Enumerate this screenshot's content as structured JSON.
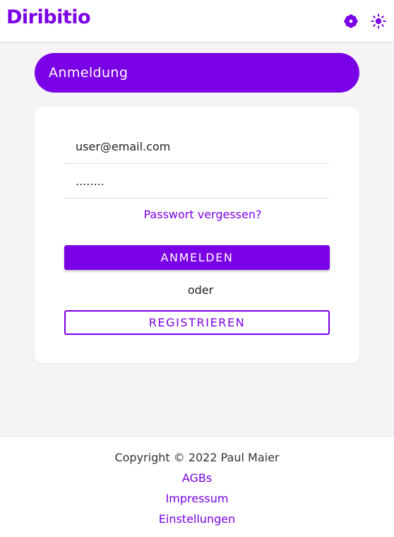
{
  "app": {
    "brand": "Diribitio"
  },
  "header": {
    "icons": [
      "settings-flower-icon",
      "sun-icon"
    ],
    "accent_color": "#7a00e6"
  },
  "page": {
    "title": "Anmeldung"
  },
  "login_form": {
    "email_value": "user@email.com",
    "password_value": "........",
    "forgot_password_label": "Passwort vergessen?",
    "login_button_label": "ANMELDEN",
    "or_label": "oder",
    "register_button_label": "REGISTRIEREN"
  },
  "footer": {
    "copyright": "Copyright © 2022 Paul Maier",
    "links": [
      "AGBs",
      "Impressum",
      "Einstellungen"
    ]
  }
}
